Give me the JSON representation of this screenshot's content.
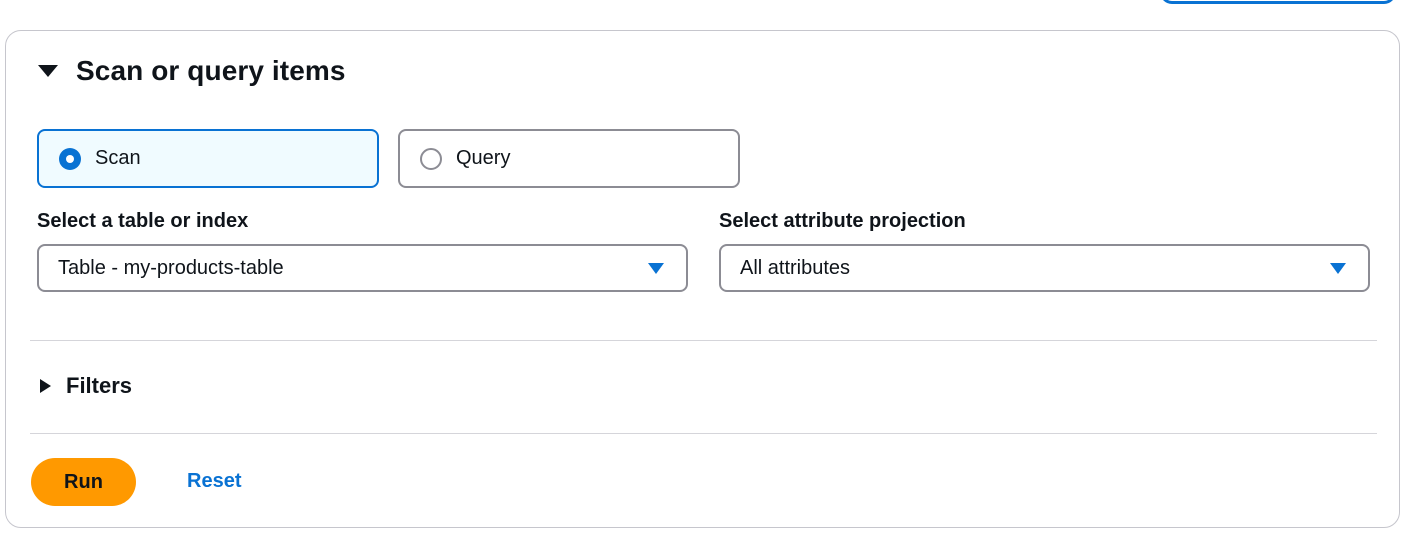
{
  "section": {
    "title": "Scan or query items",
    "expanded": true
  },
  "mode": {
    "options": [
      {
        "label": "Scan",
        "selected": true
      },
      {
        "label": "Query",
        "selected": false
      }
    ]
  },
  "table_select": {
    "label": "Select a table or index",
    "value": "Table - my-products-table"
  },
  "projection_select": {
    "label": "Select attribute projection",
    "value": "All attributes"
  },
  "filters": {
    "label": "Filters",
    "expanded": false
  },
  "actions": {
    "run_label": "Run",
    "reset_label": "Reset"
  },
  "colors": {
    "accent": "#0972d3",
    "primary_button": "#ff9900",
    "selected_tile_bg": "#f0fbff",
    "border": "#8c8c94"
  }
}
